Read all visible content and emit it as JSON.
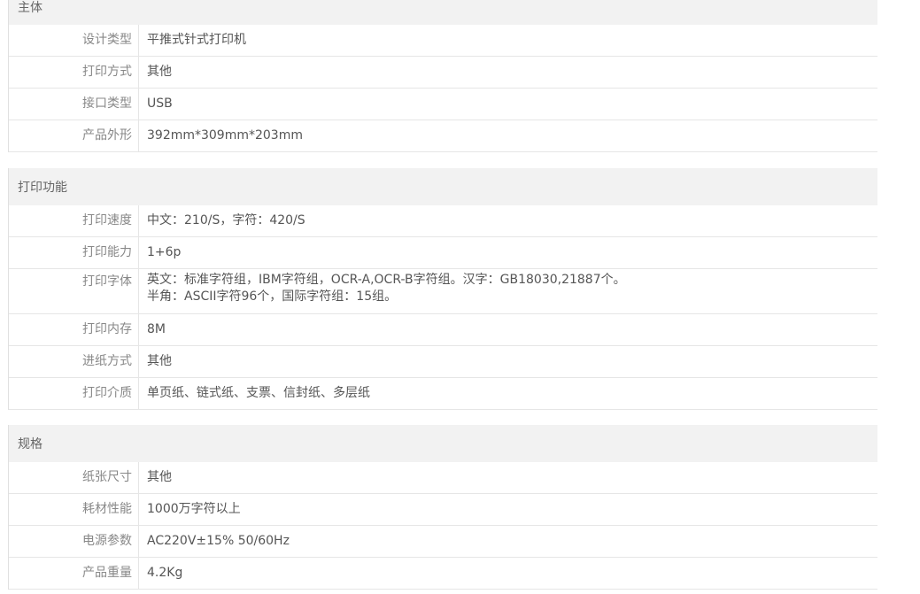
{
  "sections": [
    {
      "title": "主体",
      "rows": [
        {
          "label": "设计类型",
          "value": "平推式针式打印机"
        },
        {
          "label": "打印方式",
          "value": "其他"
        },
        {
          "label": "接口类型",
          "value": "USB"
        },
        {
          "label": "产品外形",
          "value": "392mm*309mm*203mm"
        }
      ]
    },
    {
      "title": "打印功能",
      "rows": [
        {
          "label": "打印速度",
          "value": "中文：210/S，字符：420/S"
        },
        {
          "label": "打印能力",
          "value": "1+6p"
        },
        {
          "label": "打印字体",
          "value": "英文：标准字符组，IBM字符组，OCR-A,OCR-B字符组。汉字：GB18030,21887个。",
          "value2": "半角：ASCII字符96个，国际字符组：15组。"
        },
        {
          "label": "打印内存",
          "value": "8M"
        },
        {
          "label": "进纸方式",
          "value": "其他"
        },
        {
          "label": "打印介质",
          "value": "单页纸、链式纸、支票、信封纸、多层纸"
        }
      ]
    },
    {
      "title": "规格",
      "rows": [
        {
          "label": "纸张尺寸",
          "value": "其他"
        },
        {
          "label": "耗材性能",
          "value": "1000万字符以上"
        },
        {
          "label": "电源参数",
          "value": "AC220V±15% 50/60Hz"
        },
        {
          "label": "产品重量",
          "value": "4.2Kg"
        }
      ]
    }
  ]
}
